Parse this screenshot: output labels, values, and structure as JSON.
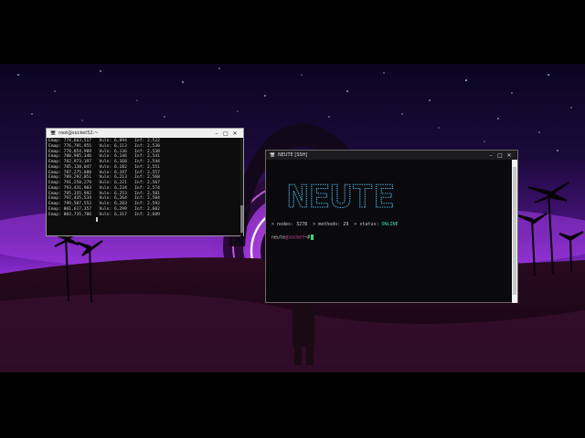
{
  "window1": {
    "title": "root@socket52:~",
    "controls": {
      "minimize": "–",
      "maximize": "□",
      "close": "✕"
    },
    "lines": [
      {
        "emap": "774,663,517",
        "vuln": "6,094",
        "inf": "2,522"
      },
      {
        "emap": "776,791,955",
        "vuln": "6,113",
        "inf": "2,530"
      },
      {
        "emap": "778,854,989",
        "vuln": "6,136",
        "inf": "2,538"
      },
      {
        "emap": "780,985,346",
        "vuln": "6,146",
        "inf": "2,541"
      },
      {
        "emap": "782,973,197",
        "vuln": "6,168",
        "inf": "2,544"
      },
      {
        "emap": "785,138,047",
        "vuln": "6,182",
        "inf": "2,551"
      },
      {
        "emap": "787,275,080",
        "vuln": "6,197",
        "inf": "2,557"
      },
      {
        "emap": "789,292,051",
        "vuln": "6,213",
        "inf": "2,568"
      },
      {
        "emap": "791,258,279",
        "vuln": "6,221",
        "inf": "2,567"
      },
      {
        "emap": "793,431,903",
        "vuln": "6,234",
        "inf": "2,574"
      },
      {
        "emap": "795,335,992",
        "vuln": "6,253",
        "inf": "2,581"
      },
      {
        "emap": "797,435,534",
        "vuln": "6,264",
        "inf": "2,584"
      },
      {
        "emap": "799,507,552",
        "vuln": "6,283",
        "inf": "2,592"
      },
      {
        "emap": "801,617,357",
        "vuln": "6,299",
        "inf": "2,602"
      },
      {
        "emap": "803,735,786",
        "vuln": "6,317",
        "inf": "2,609"
      }
    ],
    "labels": {
      "emap": "Emap:",
      "vuln": "Vuln:",
      "inf": "Inf:"
    }
  },
  "window2": {
    "title": "NEUTE [SSH]",
    "controls": {
      "minimize": "–",
      "maximize": "□",
      "close": "✕"
    },
    "banner": "NEUTE",
    "stats": {
      "nodes_label": "> nodes:",
      "nodes_value": "3278",
      "methods_label": "> methods:",
      "methods_value": "29",
      "status_label": "> status:",
      "status_value": "ONLINE"
    },
    "prompt": {
      "user": "neute",
      "at": "@",
      "host": "socket",
      "path": "~#"
    }
  },
  "colors": {
    "accent_online": "#4cd6a8",
    "banner": "#4fb0e6",
    "cursor": "#3ad67a"
  }
}
